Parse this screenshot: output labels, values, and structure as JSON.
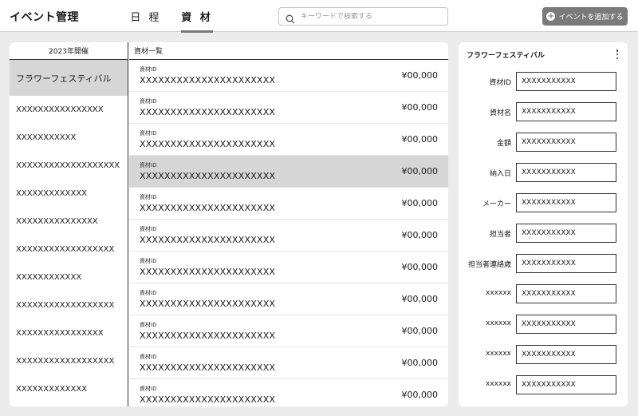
{
  "header": {
    "title": "イベント管理",
    "tabs": [
      {
        "label": "日 程"
      },
      {
        "label": "資 材"
      }
    ],
    "search_placeholder": "キーワードで検索する",
    "add_button_label": "イベントを追加する",
    "colors": {
      "accent": "#7a7a7a",
      "selected_row": "#d6d6d6"
    }
  },
  "events": {
    "header": "2023年開催",
    "items": [
      "フラワーフェスティバル",
      "XXXXXXXXXXXXXXXX",
      "XXXXXXXXXXX",
      "XXXXXXXXXXXXXXXXXXX",
      "XXXXXXXXXXXXX",
      "XXXXXXXXXXXXXXX",
      "XXXXXXXXXXXXXXXXXX",
      "XXXXXXXXXXXX",
      "XXXXXXXXXXXXXXXXXX",
      "XXXXXXXXXXXXXXXX",
      "XXXXXXXXXXXXXXXXXX",
      "XXXXXXXXXXXXX"
    ]
  },
  "materials": {
    "header": "資材一覧",
    "rows": [
      {
        "label": "資材ID",
        "id": "XXXXXXXXXXXXXXXXXXXXXX",
        "price": "¥00,000"
      },
      {
        "label": "資材ID",
        "id": "XXXXXXXXXXXXXXXXXXXXXX",
        "price": "¥00,000"
      },
      {
        "label": "資材ID",
        "id": "XXXXXXXXXXXXXXXXXXXXXX",
        "price": "¥00,000"
      },
      {
        "label": "資材ID",
        "id": "XXXXXXXXXXXXXXXXXXXXXX",
        "price": "¥00,000"
      },
      {
        "label": "資材ID",
        "id": "XXXXXXXXXXXXXXXXXXXXXX",
        "price": "¥00,000"
      },
      {
        "label": "資材ID",
        "id": "XXXXXXXXXXXXXXXXXXXXXX",
        "price": "¥00,000"
      },
      {
        "label": "資材ID",
        "id": "XXXXXXXXXXXXXXXXXXXXXX",
        "price": "¥00,000"
      },
      {
        "label": "資材ID",
        "id": "XXXXXXXXXXXXXXXXXXXXXX",
        "price": "¥00,000"
      },
      {
        "label": "資材ID",
        "id": "XXXXXXXXXXXXXXXXXXXXXX",
        "price": "¥00,000"
      },
      {
        "label": "資材ID",
        "id": "XXXXXXXXXXXXXXXXXXXXXX",
        "price": "¥00,000"
      },
      {
        "label": "資材ID",
        "id": "XXXXXXXXXXXXXXXXXXXXXX",
        "price": "¥00,000"
      }
    ]
  },
  "detail": {
    "title": "フラワーフェスティバル",
    "fields": [
      {
        "label": "資材ID",
        "value": "XXXXXXXXXXX"
      },
      {
        "label": "資材名",
        "value": "XXXXXXXXXXX"
      },
      {
        "label": "金額",
        "value": "XXXXXXXXXXX"
      },
      {
        "label": "納入日",
        "value": "XXXXXXXXXXX"
      },
      {
        "label": "メーカー",
        "value": "XXXXXXXXXXX"
      },
      {
        "label": "担当者",
        "value": "XXXXXXXXXXX"
      },
      {
        "label": "担当者連絡歳",
        "value": "XXXXXXXXXXX"
      },
      {
        "label": "xxxxxx",
        "value": "XXXXXXXXXXX"
      },
      {
        "label": "xxxxxx",
        "value": "XXXXXXXXXXX"
      },
      {
        "label": "xxxxxx",
        "value": "XXXXXXXXXXX"
      },
      {
        "label": "xxxxxx",
        "value": "XXXXXXXXXXX"
      }
    ]
  }
}
